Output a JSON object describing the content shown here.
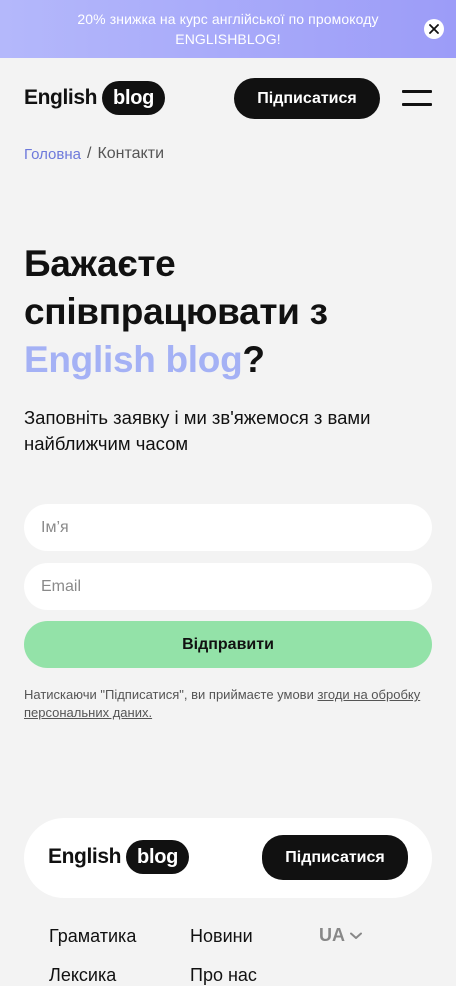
{
  "promo": {
    "text": "20% знижка на курс англійської по промокоду ENGLISHBLOG!"
  },
  "header": {
    "logo_word": "English",
    "logo_pill": "blog",
    "subscribe_label": "Підписатися"
  },
  "breadcrumb": {
    "home": "Головна",
    "separator": "/",
    "current": "Контакти"
  },
  "hero": {
    "title_part1": "Бажаєте співпрацювати з ",
    "title_accent": "English blog",
    "title_end": "?",
    "subtitle": "Заповніть заявку і ми зв'яжемося з вами найближчим часом"
  },
  "form": {
    "name_placeholder": "Ім’я",
    "email_placeholder": "Email",
    "submit_label": "Відправити",
    "consent_text": "Натискаючи \"Підписатися\", ви приймаєте умови ",
    "consent_link": "згоди на обробку персональних даних."
  },
  "footer": {
    "logo_word": "English",
    "logo_pill": "blog",
    "subscribe_label": "Підписатися",
    "nav": [
      "Граматика",
      "Новини",
      "Лексика",
      "Про нас"
    ],
    "language": "UA"
  },
  "colors": {
    "accent": "#a4b1f5",
    "link": "#6d79db",
    "submit_bg": "#93e2a8",
    "dark": "#111111"
  },
  "icons": {
    "close": "close-icon",
    "menu": "hamburger-menu-icon",
    "language_chevron": "chevron-down-icon"
  }
}
